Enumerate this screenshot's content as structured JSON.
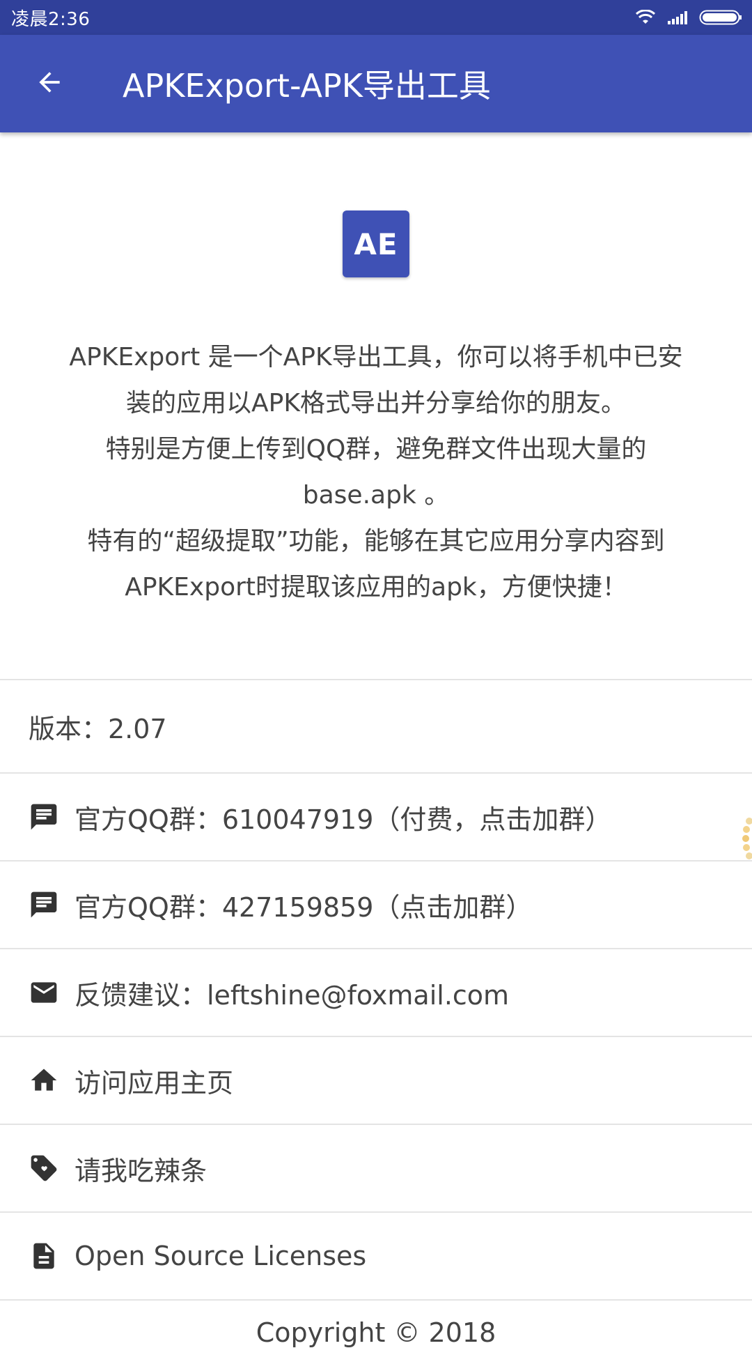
{
  "status_bar": {
    "time": "凌晨2:36",
    "icons": [
      "wifi-icon",
      "signal-icon",
      "battery-icon"
    ]
  },
  "app_bar": {
    "title": "APKExport-APK导出工具",
    "back_icon": "arrow-back-icon",
    "color": "#3f51b5"
  },
  "logo": {
    "text": "AE",
    "color": "#3f51b5"
  },
  "description": {
    "lines": [
      "APKExport 是一个APK导出工具，你可以将手机中已安",
      "装的应用以APK格式导出并分享给你的朋友。",
      "特别是方便上传到QQ群，避免群文件出现大量的",
      "base.apk 。",
      "特有的“超级提取”功能，能够在其它应用分享内容到",
      "APKExport时提取该应用的apk，方便快捷！"
    ]
  },
  "version": {
    "text": "版本：2.07"
  },
  "items": [
    {
      "label": "官方QQ群：610047919（付费，点击加群）",
      "icon": "chat-icon"
    },
    {
      "label": "官方QQ群：427159859（点击加群）",
      "icon": "chat-icon"
    },
    {
      "label": "反馈建议：leftshine@foxmail.com",
      "icon": "mail-icon"
    },
    {
      "label": "访问应用主页",
      "icon": "home-icon"
    },
    {
      "label": "请我吃辣条",
      "icon": "tag-icon"
    },
    {
      "label": "Open Source Licenses",
      "icon": "document-icon"
    }
  ],
  "copyright": {
    "text": "Copyright © 2018"
  }
}
